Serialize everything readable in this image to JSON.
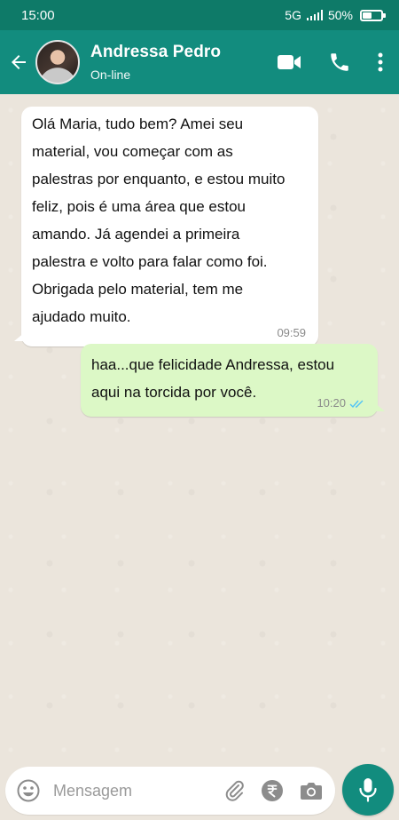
{
  "status_bar": {
    "time": "15:00",
    "network": "5G",
    "battery": "50%",
    "battery_level": 0.5
  },
  "header": {
    "contact_name": "Andressa Pedro",
    "contact_status": "On-line",
    "icons": [
      "back-arrow-icon",
      "video-call-icon",
      "phone-icon",
      "more-vert-icon"
    ]
  },
  "messages": [
    {
      "direction": "incoming",
      "text": " Olá Maria, tudo bem? Amei seu\nmaterial, vou começar com as\npalestras por enquanto, e estou muito\nfeliz, pois é uma área que estou\namando. Já agendei a primeira\npalestra e volto para falar como foi.\nObrigada pelo material, tem me\najudado muito.",
      "time": "09:59"
    },
    {
      "direction": "outgoing",
      "text": " haa...que felicidade Andressa, estou\naqui na torcida por você.",
      "time": "10:20",
      "status": "read"
    }
  ],
  "composer": {
    "placeholder": "Mensagem",
    "icons": [
      "emoji-icon",
      "attach-icon",
      "rupee-payment-icon",
      "camera-icon",
      "mic-icon"
    ]
  },
  "colors": {
    "header": "#128c7e",
    "status_bar": "#0e7a68",
    "outgoing_bubble": "#dcf8c6",
    "incoming_bubble": "#ffffff",
    "chat_background": "#ebe5dc",
    "read_ticks": "#4fc3f7"
  }
}
